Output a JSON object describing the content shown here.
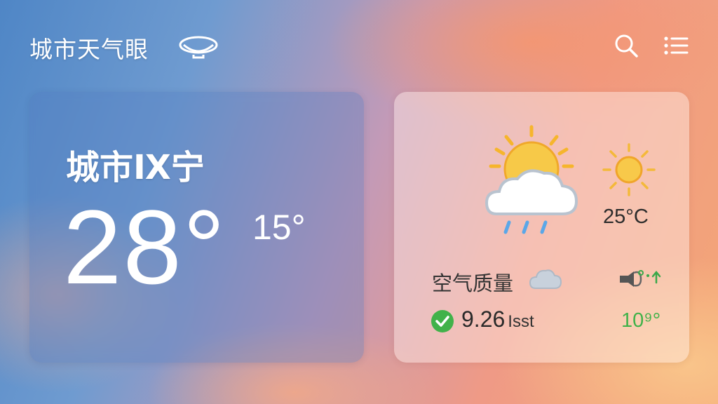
{
  "header": {
    "app_title": "城市天气眼",
    "logo_icon": "eye-icon",
    "search_icon": "search-icon",
    "menu_icon": "list-menu-icon"
  },
  "current": {
    "city": "城市Ⅸ宁",
    "temperature": "28°",
    "low_temperature": "15°"
  },
  "details": {
    "condition_icon": "sun-cloud-rain-icon",
    "secondary_icon": "sun-icon",
    "secondary_temperature": "25°C",
    "air_quality_label": "空气质量",
    "air_quality_icon": "cloud-icon",
    "air_quality_value": "9.26",
    "air_quality_unit": "Isst",
    "air_quality_status_icon": "check-icon",
    "wind_icon": "wind-icon",
    "wind_value": "10⁹°"
  },
  "colors": {
    "status_green": "#41b24a",
    "sun_yellow": "#f6c23e",
    "rain_blue": "#5aa7e8"
  }
}
